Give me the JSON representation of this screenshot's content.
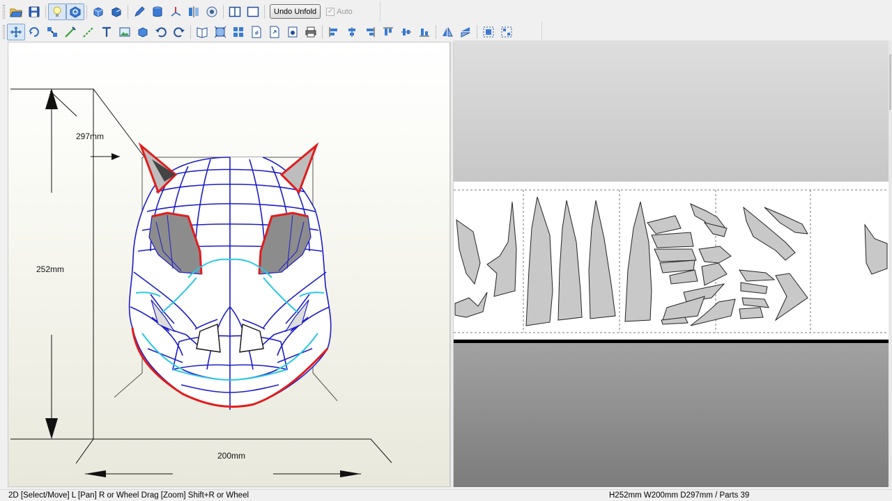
{
  "toolbar_primary": {
    "buttons": [
      "open-icon",
      "save-icon",
      "lightbulb-icon",
      "texture-toggle-icon",
      "add-part-icon",
      "unfold-part-icon",
      "edit-icon",
      "cylinder-icon",
      "axes-icon",
      "mirror-icon",
      "view-eye-icon",
      "split-view-icon",
      "single-view-icon"
    ],
    "undo_unfold_label": "Undo Unfold",
    "auto_label": "Auto",
    "auto_checked": true
  },
  "toolbar_secondary": {
    "buttons": [
      "select-move-icon",
      "rotate-edge-icon",
      "join-faces-icon",
      "draw-line-icon",
      "edit-line-icon",
      "text-icon",
      "image-icon",
      "box-icon",
      "undo-icon",
      "redo-icon",
      "book-icon",
      "fit-page-icon",
      "number-icon",
      "page-number-icon",
      "export-page-icon",
      "capture-icon",
      "print-icon",
      "align-left-icon",
      "align-center-icon",
      "align-right-icon",
      "align-top-icon",
      "align-middle-icon",
      "align-bottom-icon",
      "flip-horizontal-icon",
      "flip-vertical-icon",
      "group-icon",
      "distribute-icon"
    ]
  },
  "view3d": {
    "dimension_depth": "297mm",
    "dimension_height": "252mm",
    "dimension_width": "200mm",
    "colors": {
      "outline_blue": "#1b1bc8",
      "edge_red": "#e31b1b",
      "edge_cyan": "#28c8e6",
      "face_gray": "#8c8c8c"
    }
  },
  "status": {
    "hint": "2D [Select/Move] L [Pan] R or Wheel Drag [Zoom] Shift+R or Wheel",
    "info": "H252mm W200mm D297mm / Parts 39"
  }
}
